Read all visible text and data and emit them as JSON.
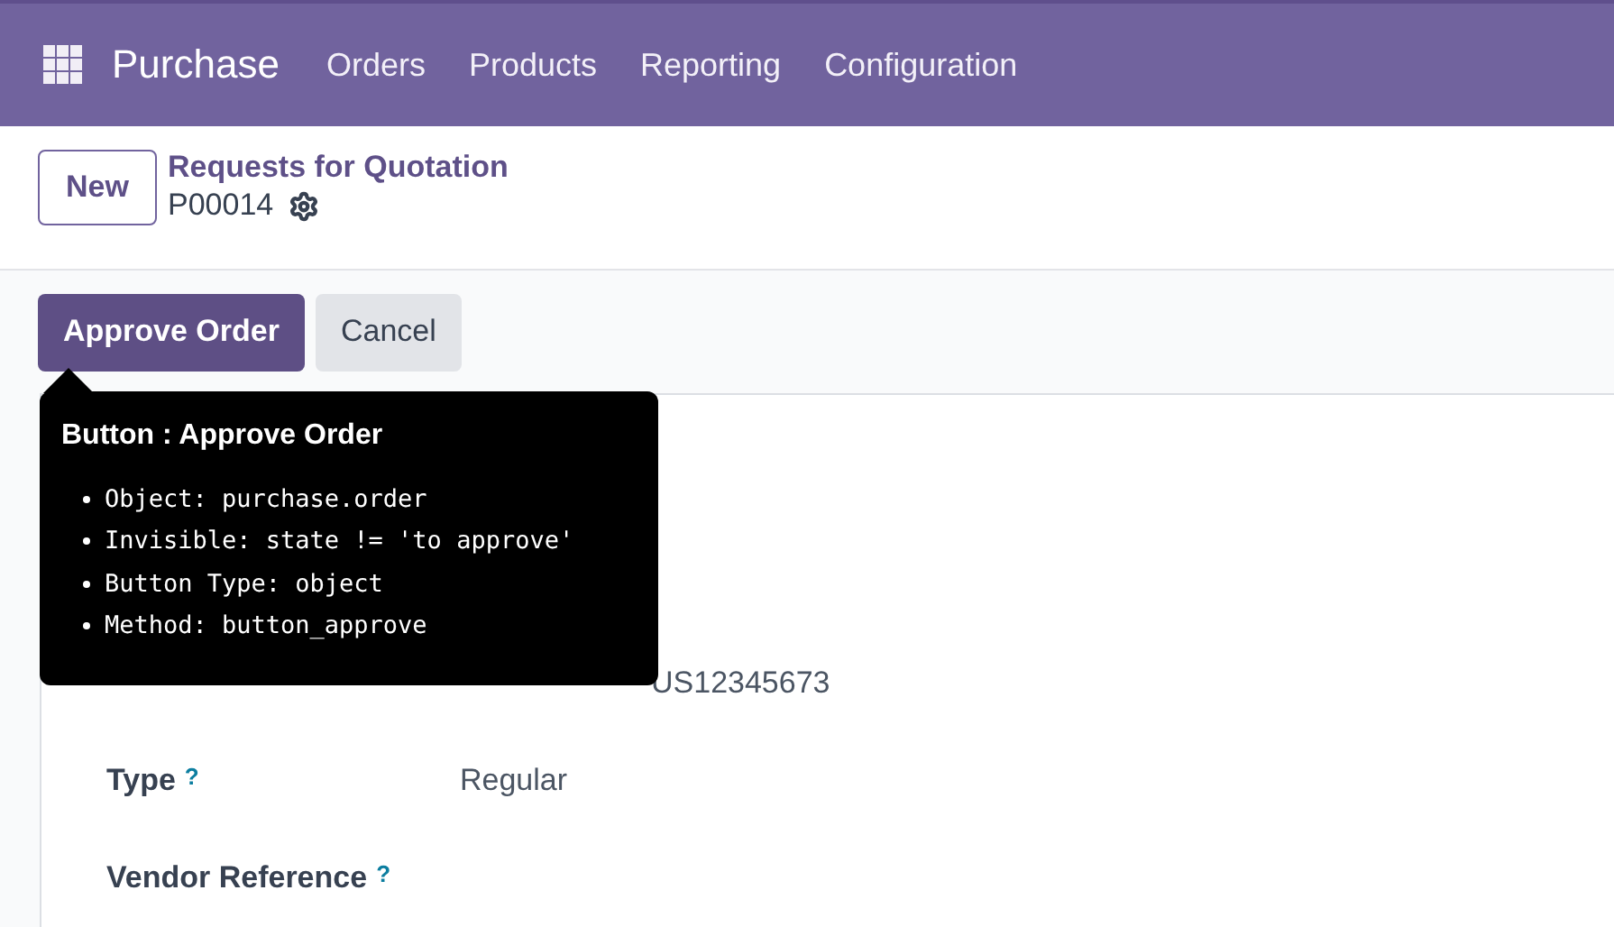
{
  "navbar": {
    "app": "Purchase",
    "menu": [
      "Orders",
      "Products",
      "Reporting",
      "Configuration"
    ]
  },
  "control_panel": {
    "new_button": "New",
    "breadcrumb": "Requests for Quotation",
    "record": "P00014"
  },
  "status_bar": {
    "buttons": [
      {
        "label": "Approve Order",
        "kind": "primary"
      },
      {
        "label": "Cancel",
        "kind": "secondary"
      }
    ]
  },
  "tooltip": {
    "title": "Button : Approve Order",
    "items": [
      "Object: purchase.order",
      "Invisible: state != 'to approve'",
      "Button Type: object",
      "Method: button_approve"
    ]
  },
  "form": {
    "fields": [
      {
        "kind": "covered",
        "value": "US12345673"
      },
      {
        "label": "Type",
        "value": "Regular",
        "help_mark": "?"
      },
      {
        "label": "Vendor Reference",
        "help_mark": "?"
      }
    ]
  }
}
